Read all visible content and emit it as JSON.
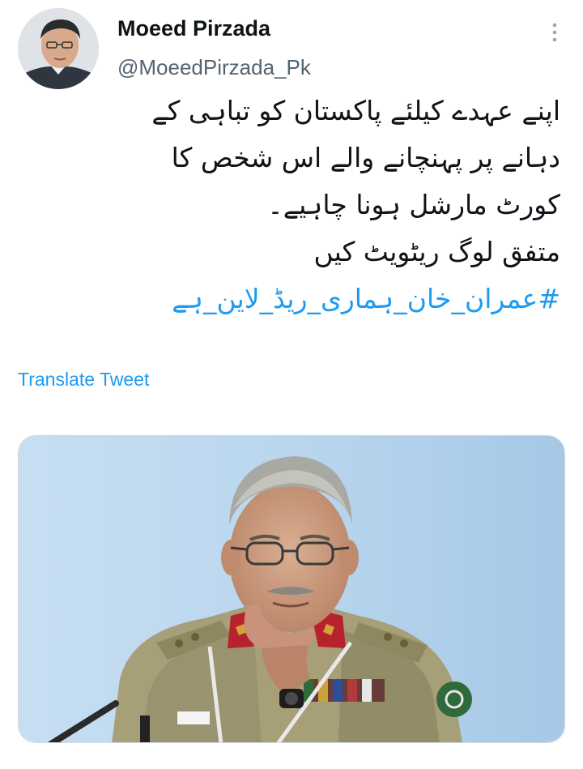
{
  "author": {
    "display_name": "Moeed Pirzada",
    "handle": "@MoeedPirzada_Pk",
    "avatar_icon": "profile-photo"
  },
  "menu": {
    "icon": "more-vertical-icon"
  },
  "tweet": {
    "lines": [
      "اپنے عہدے کیلئے پاکستان کو تباہی کے",
      "دہانے پر پہنچانے والے اس شخص کا",
      "کورٹ مارشل ہونا چاہیے۔",
      "متفق لوگ ریٹویٹ کیں"
    ],
    "hashtag": "#عمران_خان_ہماری_ریڈ_لاین_ہے",
    "translate_label": "Translate Tweet"
  },
  "media": {
    "image_icon": "photo-of-uniformed-officer"
  },
  "colors": {
    "link": "#1d9bf0",
    "text": "#0f1419",
    "secondary": "#536471"
  }
}
